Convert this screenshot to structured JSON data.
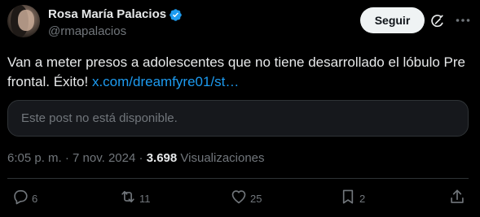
{
  "author": {
    "display_name": "Rosa María Palacios",
    "handle": "@rmapalacios",
    "verified": true
  },
  "header": {
    "follow_label": "Seguir",
    "grok_icon": "grok-icon",
    "more_icon": "more-dots-icon"
  },
  "post": {
    "text_before_link": "Van a meter presos a adolescentes que no tiene desarrollado el lóbulo Pre frontal. Éxito! ",
    "link_text": "x.com/dreamfyre01/st…"
  },
  "quoted": {
    "unavailable_text": "Este post no está disponible."
  },
  "meta": {
    "time": "6:05 p. m.",
    "separator": "·",
    "date": "7 nov. 2024",
    "views_count": "3.698",
    "views_label": "Visualizaciones"
  },
  "actions": {
    "replies": "6",
    "reposts": "11",
    "likes": "25",
    "bookmarks": "2"
  },
  "colors": {
    "background": "#000000",
    "text": "#e7e9ea",
    "muted": "#71767b",
    "link": "#1d9bf0",
    "verified": "#1d9bf0",
    "border": "#2f3336",
    "button_bg": "#eff3f4"
  }
}
